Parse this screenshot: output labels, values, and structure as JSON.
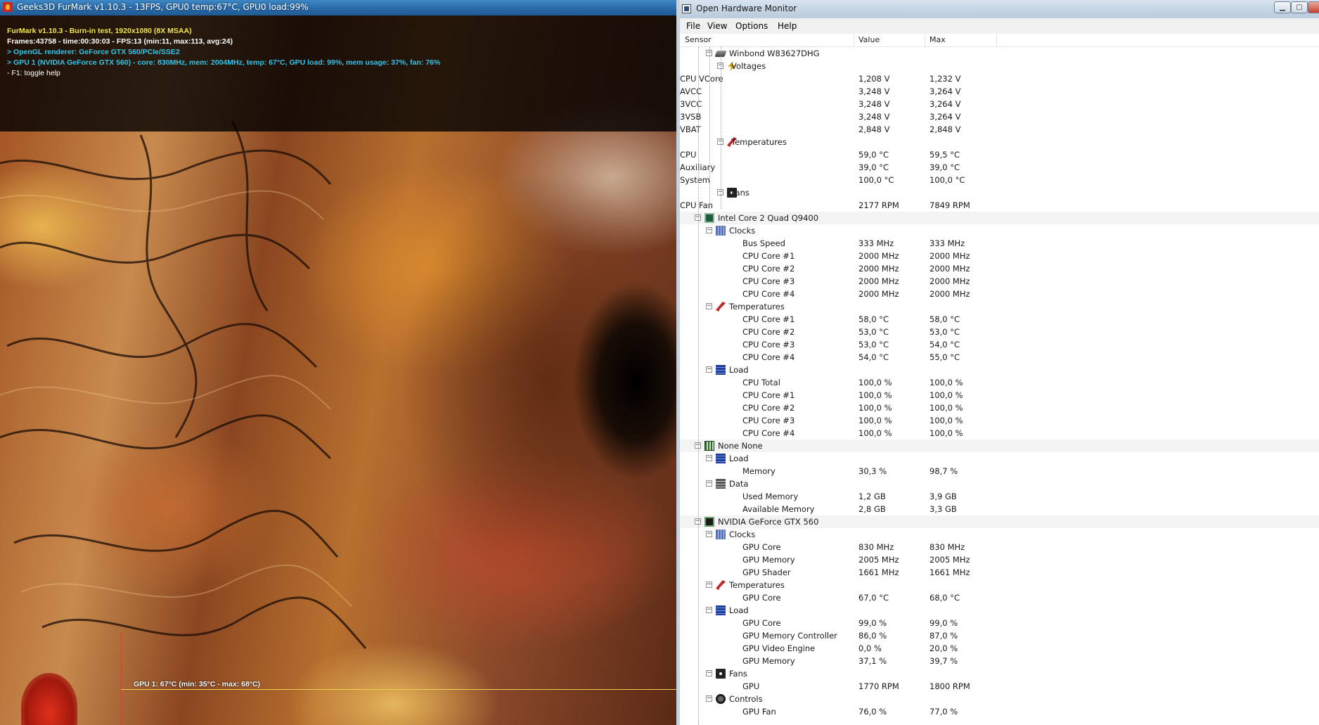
{
  "furmark": {
    "window_title": "Geeks3D FurMark v1.10.3 - 13FPS, GPU0 temp:67°C, GPU0 load:99%",
    "hud": [
      "FurMark v1.10.3 - Burn-in test, 1920x1080 (8X MSAA)",
      "Frames:43758 - time:00:30:03 - FPS:13 (min:11, max:113, avg:24)",
      "> OpenGL renderer: GeForce GTX 560/PCIe/SSE2",
      "> GPU 1 (NVIDIA GeForce GTX 560) - core: 830MHz, mem: 2004MHz, temp: 67°C, GPU load: 99%, mem usage: 37%, fan: 76%",
      "- F1: toggle help"
    ],
    "graph_label": "GPU 1: 67°C (min: 35°C - max: 68°C)"
  },
  "ohm": {
    "window_title": "Open Hardware Monitor",
    "menu": [
      "File",
      "View",
      "Options",
      "Help"
    ],
    "columns": {
      "sensor": "Sensor",
      "value": "Value",
      "max": "Max"
    },
    "rows": [
      {
        "level": 2,
        "exp": true,
        "icon": "hdd-icon",
        "label": "Winbond W83627DHG",
        "value": "",
        "max": ""
      },
      {
        "level": 3,
        "exp": true,
        "icon": "voltage-icon",
        "label": "Voltages",
        "value": "",
        "max": ""
      },
      {
        "level": 4,
        "exp": false,
        "icon": "",
        "label": "CPU VCore",
        "value": "1,208 V",
        "max": "1,232 V"
      },
      {
        "level": 4,
        "exp": false,
        "icon": "",
        "label": "AVCC",
        "value": "3,248 V",
        "max": "3,264 V"
      },
      {
        "level": 4,
        "exp": false,
        "icon": "",
        "label": "3VCC",
        "value": "3,248 V",
        "max": "3,264 V"
      },
      {
        "level": 4,
        "exp": false,
        "icon": "",
        "label": "3VSB",
        "value": "3,248 V",
        "max": "3,264 V"
      },
      {
        "level": 4,
        "exp": false,
        "icon": "",
        "label": "VBAT",
        "value": "2,848 V",
        "max": "2,848 V"
      },
      {
        "level": 3,
        "exp": true,
        "icon": "temperature-icon",
        "label": "Temperatures",
        "value": "",
        "max": ""
      },
      {
        "level": 4,
        "exp": false,
        "icon": "",
        "label": "CPU",
        "value": "59,0 °C",
        "max": "59,5 °C"
      },
      {
        "level": 4,
        "exp": false,
        "icon": "",
        "label": "Auxiliary",
        "value": "39,0 °C",
        "max": "39,0 °C"
      },
      {
        "level": 4,
        "exp": false,
        "icon": "",
        "label": "System",
        "value": "100,0 °C",
        "max": "100,0 °C"
      },
      {
        "level": 3,
        "exp": true,
        "icon": "fan-icon",
        "label": "Fans",
        "value": "",
        "max": ""
      },
      {
        "level": 4,
        "exp": false,
        "icon": "",
        "label": "CPU Fan",
        "value": "2177 RPM",
        "max": "7849 RPM"
      },
      {
        "level": 1,
        "exp": true,
        "icon": "cpu-icon",
        "label": "Intel Core 2 Quad Q9400",
        "value": "",
        "max": ""
      },
      {
        "level": 2,
        "exp": true,
        "icon": "clock-icon",
        "label": "Clocks",
        "value": "",
        "max": ""
      },
      {
        "level": 3,
        "exp": false,
        "icon": "",
        "label": "Bus Speed",
        "value": "333 MHz",
        "max": "333 MHz"
      },
      {
        "level": 3,
        "exp": false,
        "icon": "",
        "label": "CPU Core #1",
        "value": "2000 MHz",
        "max": "2000 MHz"
      },
      {
        "level": 3,
        "exp": false,
        "icon": "",
        "label": "CPU Core #2",
        "value": "2000 MHz",
        "max": "2000 MHz"
      },
      {
        "level": 3,
        "exp": false,
        "icon": "",
        "label": "CPU Core #3",
        "value": "2000 MHz",
        "max": "2000 MHz"
      },
      {
        "level": 3,
        "exp": false,
        "icon": "",
        "label": "CPU Core #4",
        "value": "2000 MHz",
        "max": "2000 MHz"
      },
      {
        "level": 2,
        "exp": true,
        "icon": "temperature-icon",
        "label": "Temperatures",
        "value": "",
        "max": ""
      },
      {
        "level": 3,
        "exp": false,
        "icon": "",
        "label": "CPU Core #1",
        "value": "58,0 °C",
        "max": "58,0 °C"
      },
      {
        "level": 3,
        "exp": false,
        "icon": "",
        "label": "CPU Core #2",
        "value": "53,0 °C",
        "max": "53,0 °C"
      },
      {
        "level": 3,
        "exp": false,
        "icon": "",
        "label": "CPU Core #3",
        "value": "53,0 °C",
        "max": "54,0 °C"
      },
      {
        "level": 3,
        "exp": false,
        "icon": "",
        "label": "CPU Core #4",
        "value": "54,0 °C",
        "max": "55,0 °C"
      },
      {
        "level": 2,
        "exp": true,
        "icon": "load-icon",
        "label": "Load",
        "value": "",
        "max": ""
      },
      {
        "level": 3,
        "exp": false,
        "icon": "",
        "label": "CPU Total",
        "value": "100,0 %",
        "max": "100,0 %"
      },
      {
        "level": 3,
        "exp": false,
        "icon": "",
        "label": "CPU Core #1",
        "value": "100,0 %",
        "max": "100,0 %"
      },
      {
        "level": 3,
        "exp": false,
        "icon": "",
        "label": "CPU Core #2",
        "value": "100,0 %",
        "max": "100,0 %"
      },
      {
        "level": 3,
        "exp": false,
        "icon": "",
        "label": "CPU Core #3",
        "value": "100,0 %",
        "max": "100,0 %"
      },
      {
        "level": 3,
        "exp": false,
        "icon": "",
        "label": "CPU Core #4",
        "value": "100,0 %",
        "max": "100,0 %"
      },
      {
        "level": 1,
        "exp": true,
        "icon": "ram-icon",
        "label": "None None",
        "value": "",
        "max": ""
      },
      {
        "level": 2,
        "exp": true,
        "icon": "load-icon",
        "label": "Load",
        "value": "",
        "max": ""
      },
      {
        "level": 3,
        "exp": false,
        "icon": "",
        "label": "Memory",
        "value": "30,3 %",
        "max": "98,7 %"
      },
      {
        "level": 2,
        "exp": true,
        "icon": "data-icon",
        "label": "Data",
        "value": "",
        "max": ""
      },
      {
        "level": 3,
        "exp": false,
        "icon": "",
        "label": "Used Memory",
        "value": "1,2 GB",
        "max": "3,9 GB"
      },
      {
        "level": 3,
        "exp": false,
        "icon": "",
        "label": "Available Memory",
        "value": "2,8 GB",
        "max": "3,3 GB"
      },
      {
        "level": 1,
        "exp": true,
        "icon": "gpu-icon",
        "label": "NVIDIA GeForce GTX 560",
        "value": "",
        "max": ""
      },
      {
        "level": 2,
        "exp": true,
        "icon": "clock-icon",
        "label": "Clocks",
        "value": "",
        "max": ""
      },
      {
        "level": 3,
        "exp": false,
        "icon": "",
        "label": "GPU Core",
        "value": "830 MHz",
        "max": "830 MHz"
      },
      {
        "level": 3,
        "exp": false,
        "icon": "",
        "label": "GPU Memory",
        "value": "2005 MHz",
        "max": "2005 MHz"
      },
      {
        "level": 3,
        "exp": false,
        "icon": "",
        "label": "GPU Shader",
        "value": "1661 MHz",
        "max": "1661 MHz"
      },
      {
        "level": 2,
        "exp": true,
        "icon": "temperature-icon",
        "label": "Temperatures",
        "value": "",
        "max": ""
      },
      {
        "level": 3,
        "exp": false,
        "icon": "",
        "label": "GPU Core",
        "value": "67,0 °C",
        "max": "68,0 °C"
      },
      {
        "level": 2,
        "exp": true,
        "icon": "load-icon",
        "label": "Load",
        "value": "",
        "max": ""
      },
      {
        "level": 3,
        "exp": false,
        "icon": "",
        "label": "GPU Core",
        "value": "99,0 %",
        "max": "99,0 %"
      },
      {
        "level": 3,
        "exp": false,
        "icon": "",
        "label": "GPU Memory Controller",
        "value": "86,0 %",
        "max": "87,0 %"
      },
      {
        "level": 3,
        "exp": false,
        "icon": "",
        "label": "GPU Video Engine",
        "value": "0,0 %",
        "max": "20,0 %"
      },
      {
        "level": 3,
        "exp": false,
        "icon": "",
        "label": "GPU Memory",
        "value": "37,1 %",
        "max": "39,7 %"
      },
      {
        "level": 2,
        "exp": true,
        "icon": "fan-icon",
        "label": "Fans",
        "value": "",
        "max": ""
      },
      {
        "level": 3,
        "exp": false,
        "icon": "",
        "label": "GPU",
        "value": "1770 RPM",
        "max": "1800 RPM"
      },
      {
        "level": 2,
        "exp": true,
        "icon": "controls-icon",
        "label": "Controls",
        "value": "",
        "max": ""
      },
      {
        "level": 3,
        "exp": false,
        "icon": "",
        "label": "GPU Fan",
        "value": "76,0 %",
        "max": "77,0 %"
      }
    ]
  }
}
